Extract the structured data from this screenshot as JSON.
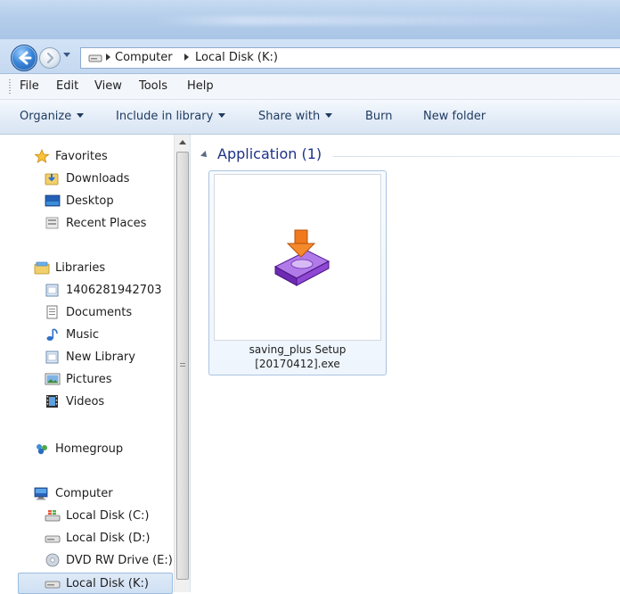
{
  "address": {
    "crumbs": [
      "Computer",
      "Local Disk (K:)"
    ]
  },
  "menu": {
    "items": [
      "File",
      "Edit",
      "View",
      "Tools",
      "Help"
    ]
  },
  "commands": {
    "organize": "Organize",
    "include_in_library": "Include in library",
    "share_with": "Share with",
    "burn": "Burn",
    "new_folder": "New folder"
  },
  "nav": {
    "favorites": {
      "label": "Favorites",
      "items": [
        "Downloads",
        "Desktop",
        "Recent Places"
      ]
    },
    "libraries": {
      "label": "Libraries",
      "items": [
        "1406281942703",
        "Documents",
        "Music",
        "New Library",
        "Pictures",
        "Videos"
      ]
    },
    "homegroup": {
      "label": "Homegroup"
    },
    "computer": {
      "label": "Computer",
      "items": [
        "Local Disk (C:)",
        "Local Disk (D:)",
        "DVD RW Drive (E:)",
        "Local Disk (K:)"
      ],
      "selected": "Local Disk (K:)"
    }
  },
  "content": {
    "group_title": "Application (1)",
    "file": {
      "name_line1": "saving_plus Setup",
      "name_line2": "[20170412].exe"
    }
  },
  "colors": {
    "accent_title": "#1e3287",
    "selection_border": "#9bbce0",
    "installer_purple": "#7a2fc4",
    "installer_arrow": "#f07a1d"
  },
  "icons": {
    "back": "arrow-left-icon",
    "forward": "arrow-right-icon",
    "favorites": "star-icon",
    "libraries": "library-icon",
    "homegroup": "homegroup-icon",
    "computer": "computer-icon",
    "file": "installer-icon"
  }
}
